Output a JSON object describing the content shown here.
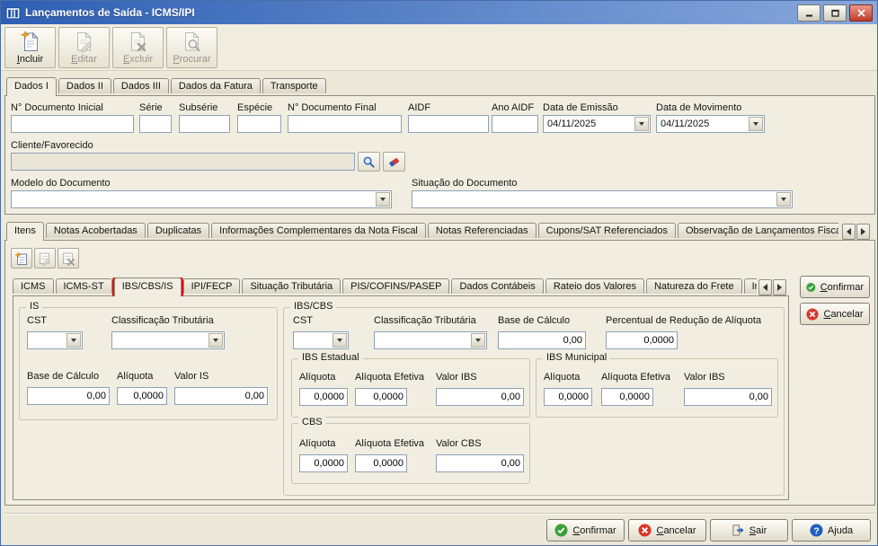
{
  "window_title": "Lançamentos de Saída - ICMS/IPI",
  "toolbar": {
    "incluir": "Incluir",
    "editar": "Editar",
    "excluir": "Excluir",
    "procurar": "Procurar"
  },
  "main_tabs": [
    "Dados I",
    "Dados II",
    "Dados III",
    "Dados da Fatura",
    "Transporte"
  ],
  "dados": {
    "doc_inicial_label": "N° Documento Inicial",
    "serie_label": "Série",
    "subserie_label": "Subsérie",
    "especie_label": "Espécie",
    "doc_final_label": "N° Documento Final",
    "aidf_label": "AIDF",
    "ano_aidf_label": "Ano AIDF",
    "data_emissao_label": "Data de Emissão",
    "data_emissao_value": "04/11/2025",
    "data_movimento_label": "Data de Movimento",
    "data_movimento_value": "04/11/2025",
    "cliente_label": "Cliente/Favorecido",
    "modelo_label": "Modelo do Documento",
    "situacao_label": "Situação do Documento"
  },
  "itens_tabs": [
    "Itens",
    "Notas Acobertadas",
    "Duplicatas",
    "Informações Complementares da Nota Fiscal",
    "Notas Referenciadas",
    "Cupons/SAT Referenciados",
    "Observação de Lançamentos Fiscais (C"
  ],
  "tax_tabs": [
    "ICMS",
    "ICMS-ST",
    "IBS/CBS/IS",
    "IPI/FECP",
    "Situação Tributária",
    "PIS/COFINS/PASEP",
    "Dados Contábeis",
    "Rateio dos Valores",
    "Natureza do Frete",
    "Informações d"
  ],
  "is_group": {
    "title": "IS",
    "cst_label": "CST",
    "class_label": "Classificação Tributária",
    "base_label": "Base de Cálculo",
    "base_value": "0,00",
    "aliq_label": "Alíquota",
    "aliq_value": "0,0000",
    "valor_label": "Valor IS",
    "valor_value": "0,00"
  },
  "ibscbs": {
    "title": "IBS/CBS",
    "cst_label": "CST",
    "class_label": "Classificação Tributária",
    "base_label": "Base de Cálculo",
    "base_value": "0,00",
    "red_label": "Percentual de Redução de Alíquota",
    "red_value": "0,0000",
    "estadual": {
      "title": "IBS Estadual",
      "aliq_label": "Alíquota",
      "aliq_value": "0,0000",
      "efet_label": "Alíquota Efetiva",
      "efet_value": "0,0000",
      "valor_label": "Valor IBS",
      "valor_value": "0,00"
    },
    "municipal": {
      "title": "IBS Municipal",
      "aliq_label": "Alíquota",
      "aliq_value": "0,0000",
      "efet_label": "Alíquota Efetiva",
      "efet_value": "0,0000",
      "valor_label": "Valor IBS",
      "valor_value": "0,00"
    },
    "cbs": {
      "title": "CBS",
      "aliq_label": "Alíquota",
      "aliq_value": "0,0000",
      "efet_label": "Alíquota Efetiva",
      "efet_value": "0,0000",
      "valor_label": "Valor CBS",
      "valor_value": "0,00"
    }
  },
  "side_buttons": {
    "confirmar": "Confirmar",
    "cancelar": "Cancelar"
  },
  "bottom_buttons": {
    "confirmar": "Confirmar",
    "cancelar": "Cancelar",
    "sair": "Sair",
    "ajuda": "Ajuda"
  }
}
